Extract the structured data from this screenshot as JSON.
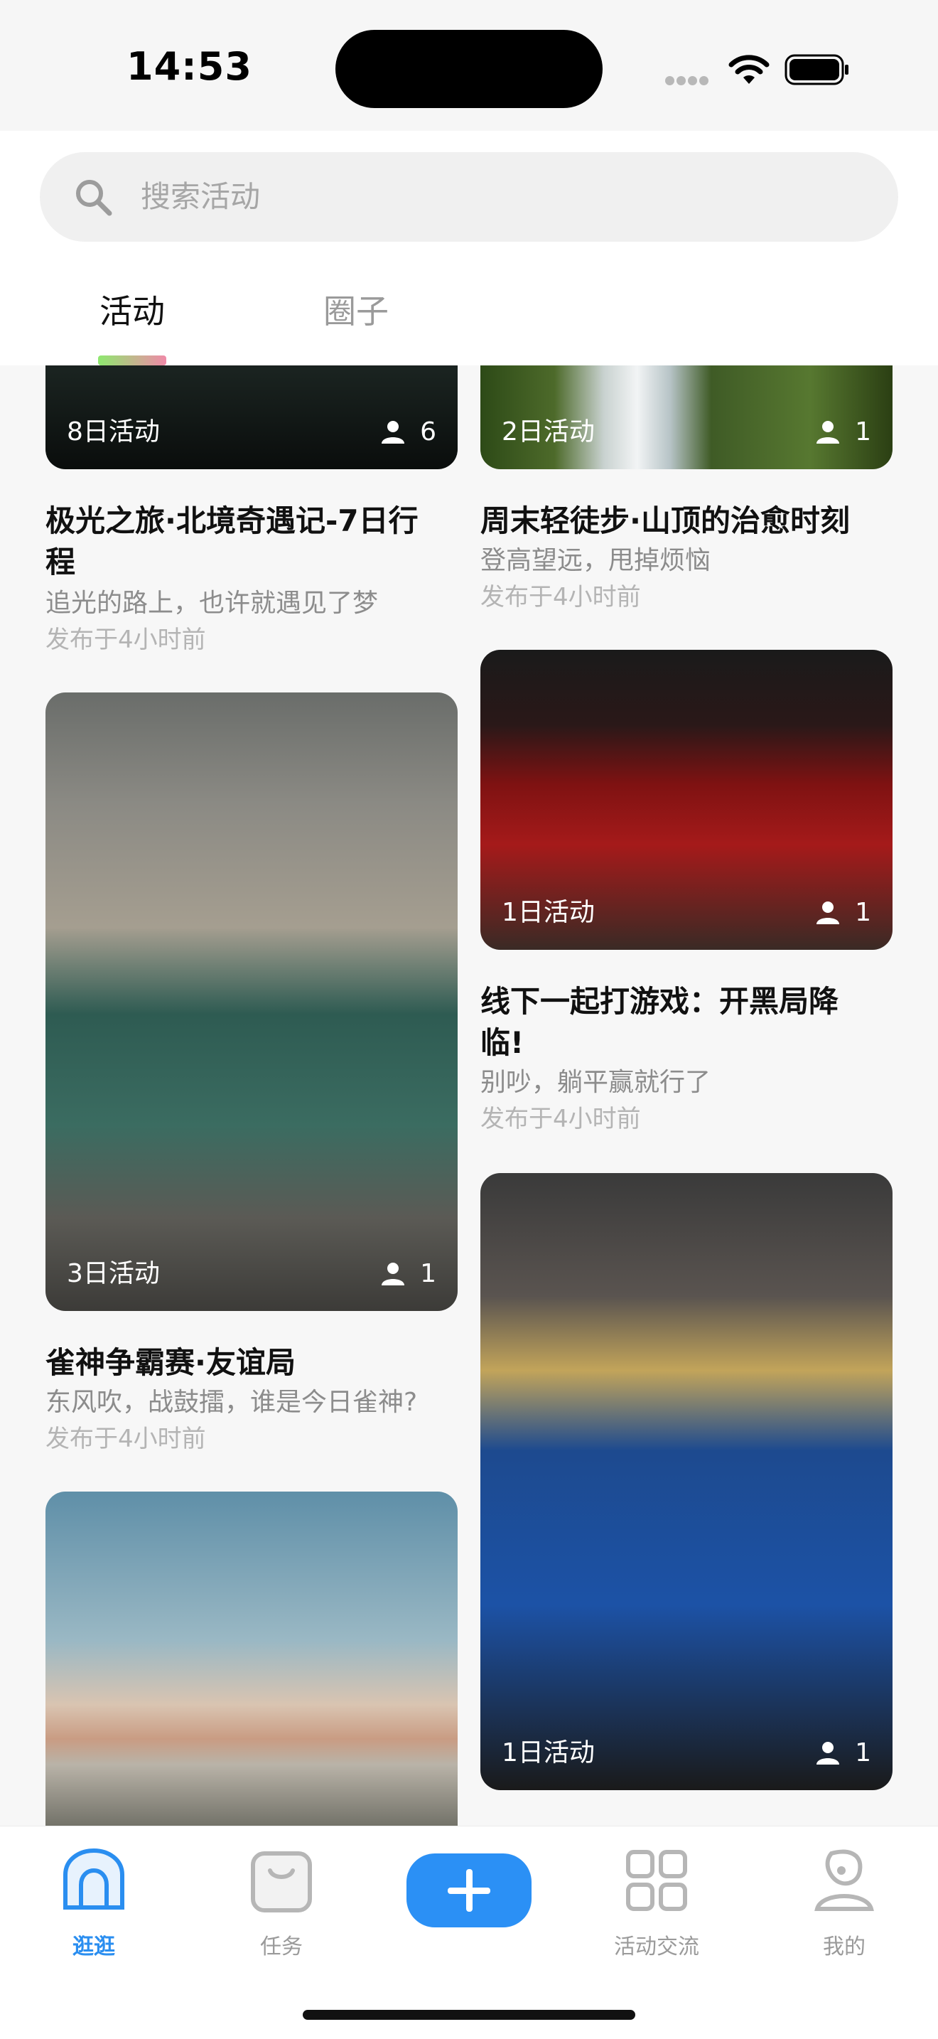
{
  "status_bar": {
    "time": "14:53"
  },
  "search": {
    "placeholder": "搜索活动"
  },
  "tabs": [
    {
      "label": "活动",
      "active": true
    },
    {
      "label": "圈子",
      "active": false
    }
  ],
  "feed": {
    "left": [
      {
        "image": "aurora-photo",
        "days": "8日活动",
        "count": "6",
        "title_lines": [
          "极光之旅·北境奇遇记-7日行",
          "程"
        ],
        "subtitle": "追光的路上，也许就遇见了梦",
        "meta": "发布于4小时前"
      },
      {
        "image": "mahjong-photo",
        "days": "3日活动",
        "count": "1",
        "title_lines": [
          "雀神争霸赛·友谊局"
        ],
        "subtitle": "东风吹，战鼓擂，谁是今日雀神?",
        "meta": "发布于4小时前"
      },
      {
        "image": "mountain-photo"
      }
    ],
    "right": [
      {
        "image": "waterfall-photo",
        "days": "2日活动",
        "count": "1",
        "title_lines": [
          "周末轻徒步·山顶的治愈时刻"
        ],
        "subtitle": "登高望远，甩掉烦恼",
        "meta": "发布于4小时前"
      },
      {
        "image": "gaming-photo",
        "days": "1日活动",
        "count": "1",
        "title_lines": [
          "线下一起打游戏：开黑局降",
          "临!"
        ],
        "subtitle": "别吵，躺平赢就行了",
        "meta": "发布于4小时前"
      },
      {
        "image": "hotpot-photo",
        "days": "1日活动",
        "count": "1"
      }
    ]
  },
  "bottom_nav": [
    {
      "label": "逛逛",
      "icon": "home-icon",
      "active": true
    },
    {
      "label": "任务",
      "icon": "bag-icon",
      "active": false
    },
    {
      "label": "",
      "icon": "plus-icon",
      "active": false
    },
    {
      "label": "活动交流",
      "icon": "grid-icon",
      "active": false
    },
    {
      "label": "我的",
      "icon": "profile-icon",
      "active": false
    }
  ],
  "colors": {
    "accent": "#2B90F5",
    "tab_underline_start": "#8EE86F",
    "tab_underline_end": "#F08AA8"
  }
}
